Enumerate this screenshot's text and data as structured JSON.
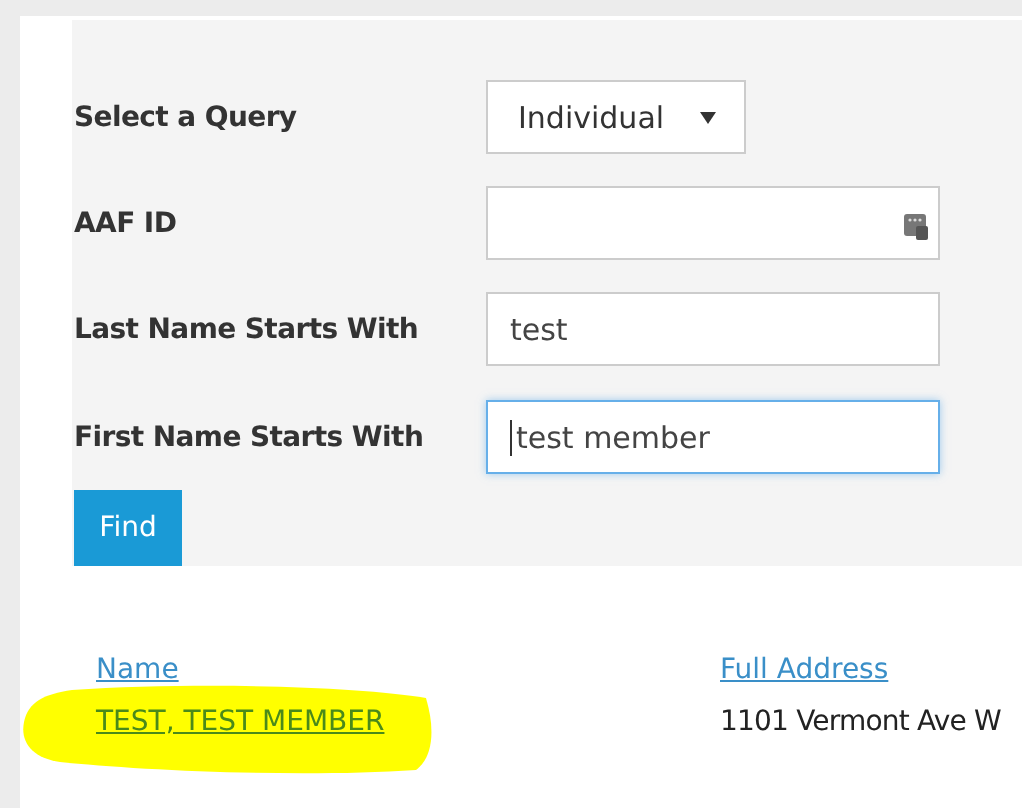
{
  "form": {
    "fields": [
      {
        "kind": "select",
        "label": "Select a Query",
        "value": "Individual",
        "focused": false
      },
      {
        "kind": "id",
        "label": "AAF ID",
        "focused": false
      },
      {
        "kind": "text",
        "label": "Last Name Starts With",
        "value": "test",
        "focused": false
      },
      {
        "kind": "text",
        "label": "First Name Starts With",
        "value": "test member",
        "focused": true
      }
    ],
    "button": "Find"
  },
  "results": {
    "columns": [
      "Name",
      "Full Address"
    ],
    "rows": [
      {
        "name": "TEST, TEST MEMBER",
        "address": "1101 Vermont Ave W",
        "highlighted": true
      }
    ]
  }
}
